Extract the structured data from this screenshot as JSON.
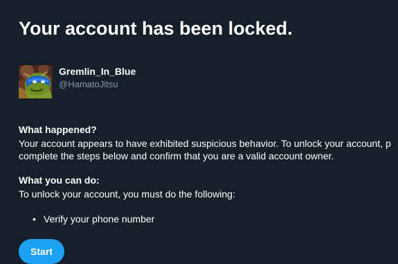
{
  "page": {
    "title": "Your account has been locked."
  },
  "account": {
    "display_name": "Gremlin_In_Blue",
    "handle": "@HamatoJitsu",
    "avatar_icon": "turtle-avatar-icon"
  },
  "sections": [
    {
      "heading": "What happened?",
      "lines": [
        "Your account appears to have exhibited suspicious behavior. To unlock your account, p",
        "complete the steps below and confirm that you are a valid account owner."
      ]
    },
    {
      "heading": "What you can do:",
      "lines": [
        "To unlock your account, you must do the following:"
      ]
    }
  ],
  "steps": [
    "Verify your phone number"
  ],
  "actions": {
    "start_label": "Start"
  },
  "colors": {
    "background": "#15202b",
    "accent": "#1da1f2",
    "muted_text": "#8899a6"
  }
}
